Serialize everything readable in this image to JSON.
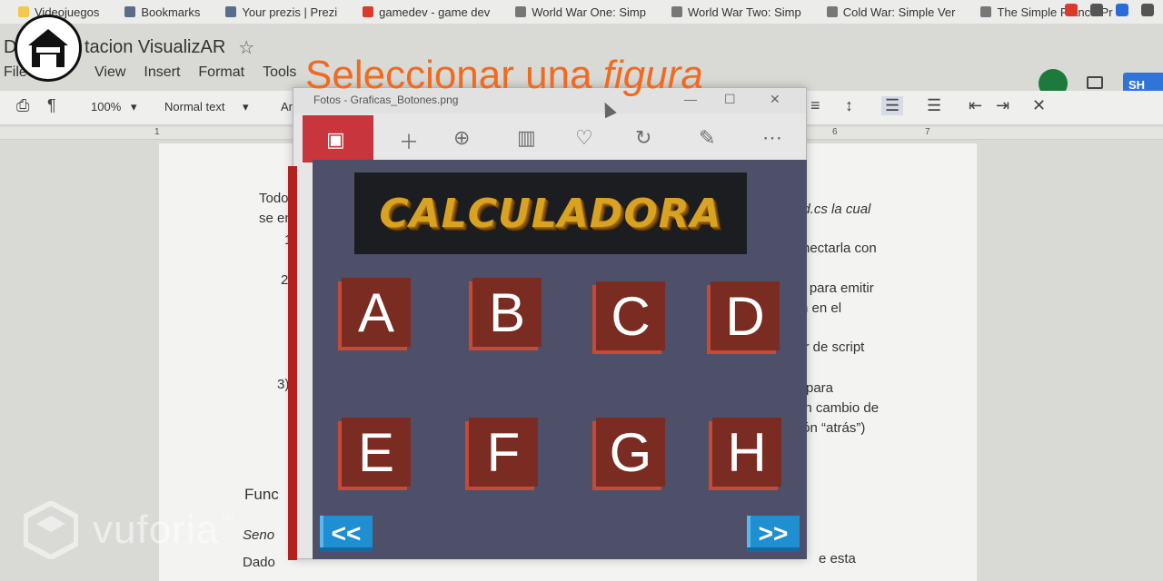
{
  "bookmarks": [
    "Videojuegos",
    "Bookmarks",
    "Your prezis | Prezi",
    "gamedev - game dev",
    "World War One: Simp",
    "World War Two: Simp",
    "Cold War: Simple Ver",
    "The Simple Franco-Pr"
  ],
  "docs": {
    "title_prefix": "D",
    "title": "tacion VisualizAR",
    "menu": [
      "File",
      "View",
      "Insert",
      "Format",
      "Tools"
    ],
    "zoom": "100%",
    "style": "Normal text",
    "font": "Aria",
    "share": "SH",
    "ruler_numbers": [
      "1",
      "6",
      "7"
    ],
    "body_lines": [
      "Todos",
      "se en",
      "1)",
      "2)",
      "3)",
      "Func",
      "Seno",
      "Dado",
      "nd.cs la cual",
      "nectarla con",
      "s, para emitir",
      "n en el",
      "rtir de script",
      "para",
      "un cambio de",
      "tón “atrás”)",
      "e esta"
    ]
  },
  "overlay": {
    "home_icon": "home-icon",
    "header_plain": "Seleccionar una",
    "header_italic": "figura",
    "watermark": "vuforia",
    "trademark": "TM"
  },
  "photos_window": {
    "title": "Fotos - Graficas_Botones.png",
    "toolbar_icons": [
      "image-icon",
      "add-icon",
      "zoom-icon",
      "delete-icon",
      "favorite-icon",
      "rotate-icon",
      "edit-icon",
      "more-icon"
    ]
  },
  "game": {
    "banner": "CALCULADORA",
    "letters": [
      "A",
      "B",
      "C",
      "D",
      "E",
      "F",
      "G",
      "H"
    ],
    "prev_label": "<<",
    "next_label": ">>"
  },
  "colors": {
    "header": "#f06a1f",
    "letter_button": "#7a2c22",
    "nav_button": "#1f8fd1",
    "panel": "#4d5068"
  }
}
